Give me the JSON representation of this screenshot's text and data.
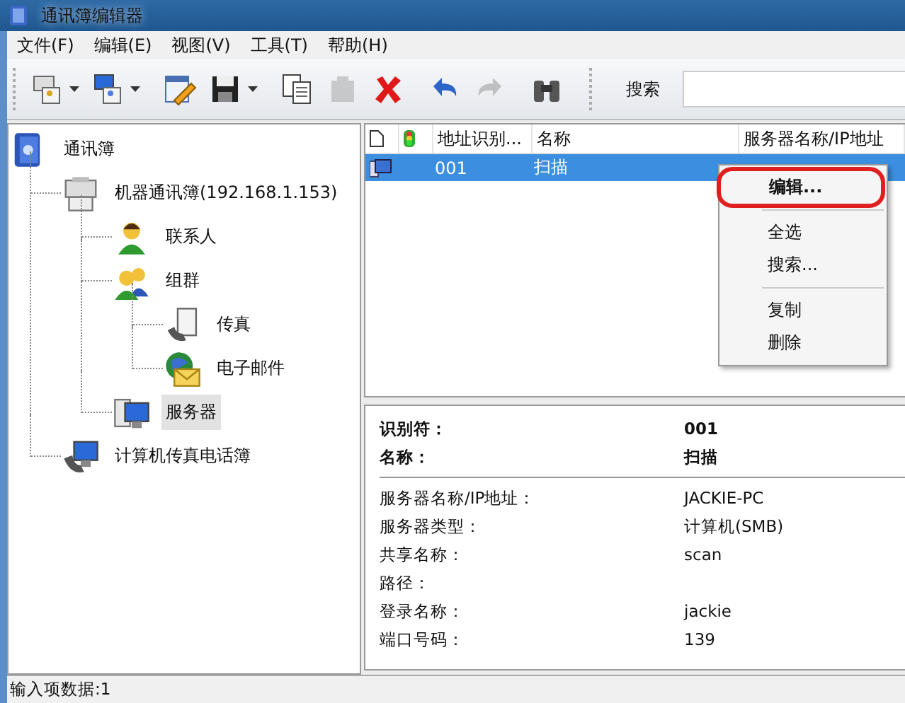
{
  "window": {
    "title": "通讯簿编辑器"
  },
  "menu_bar": [
    "文件(F)",
    "编辑(E)",
    "视图(V)",
    "工具(T)",
    "帮助(H)"
  ],
  "toolbar": [
    {
      "kind": "add-device",
      "dropdown": true,
      "disabled": false
    },
    {
      "kind": "add-computer",
      "dropdown": true,
      "disabled": false
    },
    {
      "kind": "edit",
      "dropdown": false,
      "disabled": false
    },
    {
      "kind": "save",
      "dropdown": true,
      "disabled": false
    },
    {
      "kind": "copy",
      "dropdown": false,
      "disabled": false
    },
    {
      "kind": "paste",
      "dropdown": false,
      "disabled": true
    },
    {
      "kind": "delete",
      "dropdown": false,
      "disabled": false
    },
    {
      "kind": "undo",
      "dropdown": false,
      "disabled": false
    },
    {
      "kind": "redo",
      "dropdown": false,
      "disabled": true
    },
    {
      "kind": "find",
      "dropdown": false,
      "disabled": false
    }
  ],
  "search": {
    "label": "搜索"
  },
  "tree": [
    {
      "label": "通讯簿",
      "kind": "book",
      "selected": false,
      "children": [
        {
          "label": "机器通讯簿(192.168.1.153)",
          "kind": "device",
          "selected": false,
          "children": [
            {
              "label": "联系人",
              "kind": "person",
              "selected": false
            },
            {
              "label": "组群",
              "kind": "group",
              "selected": false,
              "children": [
                {
                  "label": "传真",
                  "kind": "fax",
                  "selected": false
                },
                {
                  "label": "电子邮件",
                  "kind": "email",
                  "selected": false
                }
              ]
            },
            {
              "label": "服务器",
              "kind": "server",
              "selected": true
            }
          ]
        },
        {
          "label": "计算机传真电话簿",
          "kind": "computer",
          "selected": false
        }
      ]
    }
  ],
  "list": {
    "columns": [
      "地址识别...",
      "名称",
      "服务器名称/IP地址"
    ],
    "rows": [
      {
        "selected": true,
        "cells": [
          "001",
          "扫描"
        ]
      }
    ]
  },
  "context_menu": {
    "groups": [
      [
        {
          "label": "编辑...",
          "default": true
        }
      ],
      [
        {
          "label": "全选",
          "default": false
        },
        {
          "label": "搜索...",
          "default": false
        }
      ],
      [
        {
          "label": "复制",
          "default": false
        },
        {
          "label": "删除",
          "default": false
        }
      ]
    ]
  },
  "details": {
    "header": [
      {
        "label": "识别符：",
        "value": "001"
      },
      {
        "label": "名称：",
        "value": "扫描"
      }
    ],
    "fields": [
      {
        "label": "服务器名称/IP地址：",
        "value": "JACKIE-PC"
      },
      {
        "label": "服务器类型：",
        "value": "计算机(SMB)"
      },
      {
        "label": "共享名称：",
        "value": "scan"
      },
      {
        "label": "路径："
      },
      {
        "label": "登录名称：",
        "value": "jackie"
      },
      {
        "label": "端口号码：",
        "value": "139"
      }
    ]
  },
  "status_bar": "输入项数据:1"
}
